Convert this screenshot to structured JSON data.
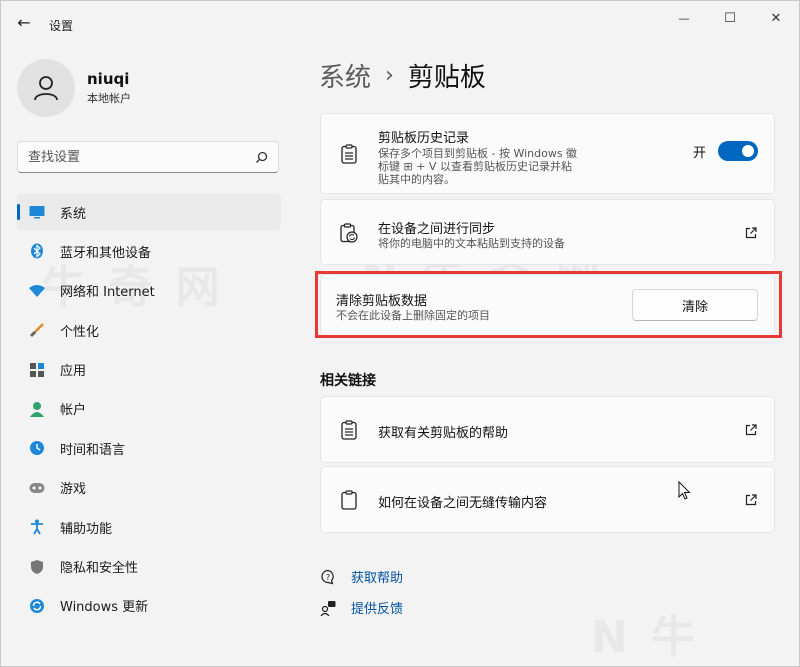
{
  "window": {
    "title": "设置",
    "back": "←",
    "minimize": "—",
    "maximize": "☐",
    "close": "✕"
  },
  "profile": {
    "name": "niuqi",
    "account_type": "本地帐户"
  },
  "search": {
    "placeholder": "查找设置"
  },
  "sidebar": {
    "items": [
      {
        "label": "系统",
        "icon": "system-icon",
        "active": true
      },
      {
        "label": "蓝牙和其他设备",
        "icon": "bluetooth-icon"
      },
      {
        "label": "网络和 Internet",
        "icon": "network-icon"
      },
      {
        "label": "个性化",
        "icon": "personalization-icon"
      },
      {
        "label": "应用",
        "icon": "apps-icon"
      },
      {
        "label": "帐户",
        "icon": "account-icon"
      },
      {
        "label": "时间和语言",
        "icon": "time-language-icon"
      },
      {
        "label": "游戏",
        "icon": "gaming-icon"
      },
      {
        "label": "辅助功能",
        "icon": "accessibility-icon"
      },
      {
        "label": "隐私和安全性",
        "icon": "privacy-icon"
      },
      {
        "label": "Windows 更新",
        "icon": "windows-update-icon"
      }
    ]
  },
  "breadcrumb": {
    "parent": "系统",
    "separator": "›",
    "current": "剪贴板"
  },
  "cards": {
    "history": {
      "title": "剪贴板历史记录",
      "desc_line1": "保存多个项目到剪贴板 - 按 Windows 徽",
      "desc_line2": "标键 ⊞ + V 以查看剪贴板历史记录并粘",
      "desc_line3": "贴其中的内容。",
      "toggle_label": "开",
      "toggle_on": true
    },
    "sync": {
      "title": "在设备之间进行同步",
      "desc": "将你的电脑中的文本粘贴到支持的设备"
    },
    "clear": {
      "title": "清除剪贴板数据",
      "desc": "不会在此设备上删除固定的项目",
      "button": "清除"
    }
  },
  "related": {
    "header": "相关链接",
    "links": [
      {
        "label": "获取有关剪贴板的帮助"
      },
      {
        "label": "如何在设备之间无缝传输内容"
      }
    ]
  },
  "help": {
    "get_help": "获取帮助",
    "feedback": "提供反馈"
  },
  "colors": {
    "accent": "#0067c0",
    "highlight": "#e53935",
    "background": "#f3f3f3"
  }
}
